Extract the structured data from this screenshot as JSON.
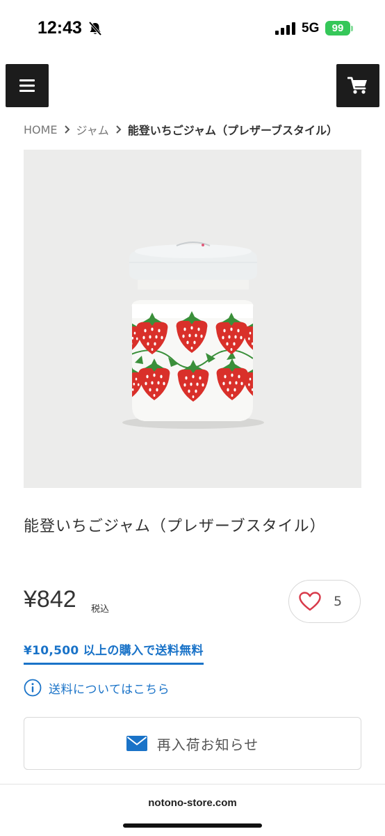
{
  "status_bar": {
    "time": "12:43",
    "network": "5G",
    "battery": "99"
  },
  "header": {
    "menu_icon": "hamburger-menu-icon",
    "cart_icon": "cart-icon"
  },
  "breadcrumb": {
    "items": [
      "HOME",
      "ジャム",
      "能登いちごジャム（プレザーブスタイル）"
    ]
  },
  "product": {
    "title": "能登いちごジャム（プレザーブスタイル）",
    "price": "¥842",
    "tax_label": "税込",
    "favorite_count": "5",
    "free_shipping": "¥10,500 以上の購入で送料無料",
    "shipping_info": "送料についてはこちら",
    "restock_button": "再入荷お知らせ"
  },
  "browser": {
    "url": "notono-store.com"
  },
  "colors": {
    "accent": "#1a73c8",
    "header_button_bg": "#1c1c1c",
    "battery": "#35c759",
    "strawberry": "#d9302a",
    "leaf": "#3a8f3a"
  }
}
